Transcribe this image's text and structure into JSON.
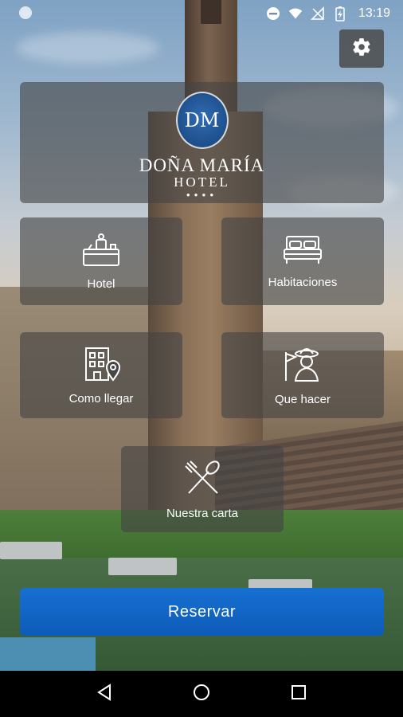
{
  "status_bar": {
    "time": "13:19",
    "icons": [
      "notification-dot-icon",
      "do-not-disturb-icon",
      "wifi-icon",
      "no-signal-icon",
      "battery-charging-icon"
    ]
  },
  "settings": {
    "icon": "gear-icon"
  },
  "logo": {
    "monogram": "DM",
    "name": "DOÑA MARÍA",
    "subtitle": "HOTEL",
    "stars": "●●●●"
  },
  "menu": {
    "hotel": {
      "label": "Hotel",
      "icon": "reception-desk-icon"
    },
    "habitaciones": {
      "label": "Habitaciones",
      "icon": "bed-icon"
    },
    "como_llegar": {
      "label": "Como llegar",
      "icon": "building-location-icon"
    },
    "que_hacer": {
      "label": "Que hacer",
      "icon": "tour-guide-icon"
    },
    "nuestra_carta": {
      "label": "Nuestra carta",
      "icon": "fork-spoon-icon"
    }
  },
  "reserve": {
    "label": "Reservar"
  },
  "nav_bar": {
    "icons": [
      "back-icon",
      "home-icon",
      "recents-icon"
    ]
  },
  "colors": {
    "tile_overlay": "#444444",
    "primary_button": "#1268c8",
    "nav_bar": "#000000"
  }
}
